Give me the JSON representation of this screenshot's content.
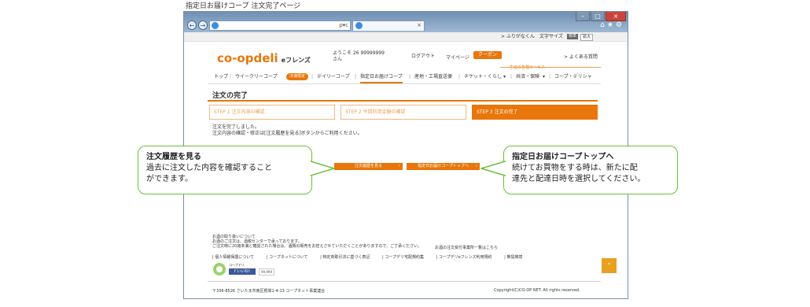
{
  "caption": "指定日お届けコープ 注文完了ページ",
  "browser": {
    "close_glyph": "×",
    "tab_close": "×",
    "address_controls": "ρ▾c",
    "tools_icons": "⌂★⚙"
  },
  "utility": {
    "yomigana": "> ふりがなくん",
    "font_size_label": "文字サイズ",
    "standard": "標準",
    "large": "拡大"
  },
  "header": {
    "logo": "co-opdeli",
    "logo_sub": "eフレンズ",
    "welcome_line1": "ようこそ 26 99999999",
    "welcome_line2": "さん",
    "logout": "ログアウト",
    "mypage": "マイページ",
    "coupon": "クーポン",
    "faq": "> よくある質問"
  },
  "gnav": {
    "service_label": "生協の各種サービス",
    "items": [
      "トップ",
      "ウイークリーコープ",
      "冷凍限定",
      "デイリーコープ",
      "指定日お届けコープ",
      "産地・工場直送便",
      "チケット・くらし",
      "共済・保険",
      "コープ・デリシャ"
    ],
    "separator": "|",
    "dropdown_glyph": "▾"
  },
  "page": {
    "title": "注文の完了",
    "steps": [
      "STEP 1 注文内容の確認",
      "STEP 2 今回利用金額の確認",
      "STEP 3 注文の完了"
    ],
    "message_line1": "注文を完了しました。",
    "message_line2": "注文内容の確認・修正は[注文履歴を見る]ボタンからご利用ください。",
    "btn_history": "注文履歴を見る",
    "btn_top": "指定日お届けコープトップへ",
    "btn_arrow": "›"
  },
  "footer": {
    "note_title": "お酒の取り扱いについて",
    "note_line1": "お酒のご注文は、酒税センターで承っております。",
    "note_line2": "ご注文時に20歳未満と確認された場合は、酒類の販売をお控えさせていただくことがありますので、ご了承ください。",
    "note_link": "お酒の注文受付事業所一覧はこちら",
    "links": [
      "| 個人情報保護について",
      "| コープネットについて",
      "| 特定商取引法に基づく表記",
      "| コープデリ宅配規約集",
      "| コープデリeフレンズ利用規約",
      "| 推奨環境"
    ],
    "coop_app": "コープデリ",
    "fb_like": "いいね!",
    "fb_count": "99,999",
    "totop": "⌃",
    "address": "〒336-8526 さいたま市南区根岸1-4-13 コープネット事業連合",
    "copyright": "Copyright(C)CO-OP NET. All rights reserved."
  },
  "callouts": {
    "left_title": "注文履歴を見る",
    "left_body1": "過去に注文した内容を確認すること",
    "left_body2": "ができます。",
    "right_title": "指定日お届けコープトップへ",
    "right_body1": "続けてお買物をする時は、新たに配",
    "right_body2": "達先と配達日時を選択してください。"
  },
  "colors": {
    "accent": "#e8760a",
    "callout_border": "#6cbf3b",
    "browser_chrome": "#6f8fb3"
  }
}
